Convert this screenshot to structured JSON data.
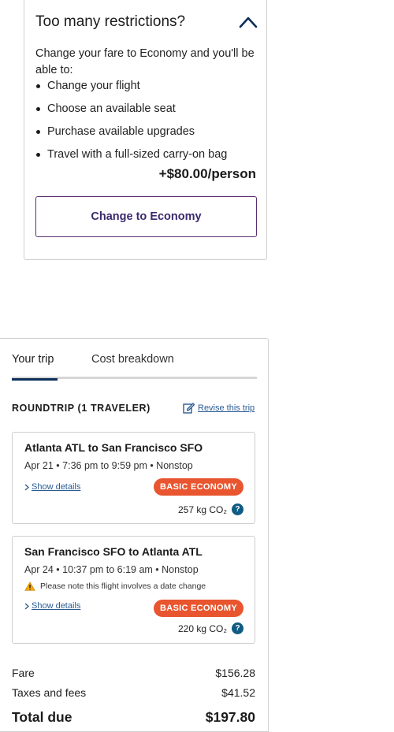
{
  "restrictions": {
    "title": "Too many restrictions?",
    "intro": "Change your fare to Economy and you'll be able to:",
    "benefits": [
      "Change your flight",
      "Choose an available seat",
      "Purchase available upgrades",
      "Travel with a full-sized carry-on bag"
    ],
    "price": "+$80.00/person",
    "button_label": "Change to Economy",
    "chevron_icon": "chevron-up-icon"
  },
  "trip": {
    "tabs": [
      {
        "label": "Your trip",
        "active": true
      },
      {
        "label": "Cost breakdown",
        "active": false
      }
    ],
    "roundtrip_label": "ROUNDTRIP (1 TRAVELER)",
    "revise_label": "Revise this trip",
    "flights": [
      {
        "route": "Atlanta ATL to San Francisco SFO",
        "time": "Apr 21 • 7:36 pm to 9:59 pm • Nonstop",
        "details_label": "Show details",
        "fare_class": "BASIC ECONOMY",
        "co2": "257 kg CO₂"
      },
      {
        "route": "San Francisco SFO to Atlanta ATL",
        "time": "Apr 24 • 10:37 pm to 6:19 am • Nonstop",
        "warning": "Please note this flight involves a date change",
        "details_label": "Show details",
        "fare_class": "BASIC ECONOMY",
        "co2": "220 kg CO₂"
      }
    ],
    "costs": {
      "fare_label": "Fare",
      "fare_value": "$156.28",
      "taxes_label": "Taxes and fees",
      "taxes_value": "$41.52",
      "total_label": "Total due",
      "total_value": "$197.80"
    }
  },
  "colors": {
    "badge": "#e8552f",
    "link": "#2a5b93",
    "button_border": "#5b2e6f",
    "tab_indicator": "#0b2f57",
    "info_icon": "#0f5b83"
  }
}
